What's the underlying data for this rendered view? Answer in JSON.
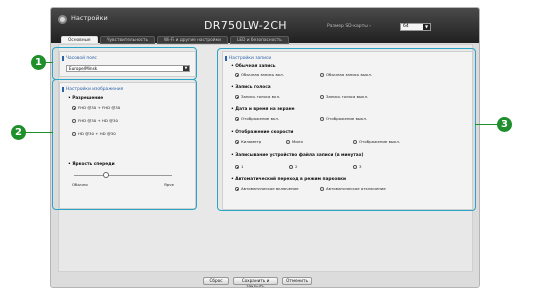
{
  "window": {
    "app_title": "Настройки",
    "model": "DR750LW-2CH",
    "card_label": "Размер SD-карты",
    "card_value": "64"
  },
  "tabs": [
    {
      "label": "Основные",
      "active": true
    },
    {
      "label": "Чувствительность",
      "active": false
    },
    {
      "label": "Wi-Fi и другие настройки",
      "active": false
    },
    {
      "label": "LED и безопасность",
      "active": false
    }
  ],
  "time_zone": {
    "title": "Часовой пояс",
    "selected": "Europe/Minsk"
  },
  "image": {
    "title": "Настройки изображения",
    "resolution_label": "Разрешение",
    "options": [
      {
        "label": "FHD @30 + FHD @30",
        "selected": true
      },
      {
        "label": "FHD @30 + HD @30",
        "selected": false
      },
      {
        "label": "HD @30 + HD @30",
        "selected": false
      }
    ],
    "brightness_label": "Яркость спереди",
    "brightness_min": "Обычно",
    "brightness_max": "Ярче",
    "brightness_level": 0.33
  },
  "record": {
    "title": "Настройки записи",
    "groups": [
      {
        "label": "Обычная запись",
        "options": [
          {
            "label": "Обычная запись вкл.",
            "selected": true
          },
          {
            "label": "Обычная запись выкл.",
            "selected": false
          }
        ]
      },
      {
        "label": "Запись голоса",
        "options": [
          {
            "label": "Запись голоса вкл.",
            "selected": true
          },
          {
            "label": "Запись голоса выкл.",
            "selected": false
          }
        ]
      },
      {
        "label": "Дата и время на экране",
        "options": [
          {
            "label": "Отображение вкл.",
            "selected": true
          },
          {
            "label": "Отображение выкл.",
            "selected": false
          }
        ]
      },
      {
        "label": "Отображение скорости",
        "options": [
          {
            "label": "Километр",
            "selected": true
          },
          {
            "label": "Миля",
            "selected": false
          },
          {
            "label": "Отображение выкл.",
            "selected": false
          }
        ]
      },
      {
        "label": "Записывание устройство файла записи (в минутах)",
        "options": [
          {
            "label": "1",
            "selected": true
          },
          {
            "label": "2",
            "selected": false
          },
          {
            "label": "3",
            "selected": false
          }
        ]
      },
      {
        "label": "Автоматический переход в режим парковки",
        "options": [
          {
            "label": "Автоматическое включение",
            "selected": true
          },
          {
            "label": "Автоматическое отключение",
            "selected": false
          }
        ]
      }
    ]
  },
  "buttons": {
    "reset": "Сброс",
    "save_close": "Сохранить и закрыть",
    "cancel": "Отменить"
  },
  "callouts": [
    "1",
    "2",
    "3"
  ],
  "colors": {
    "accent": "#2b62a8",
    "highlight": "#2aa5c7",
    "callout": "#1f8f2c"
  }
}
